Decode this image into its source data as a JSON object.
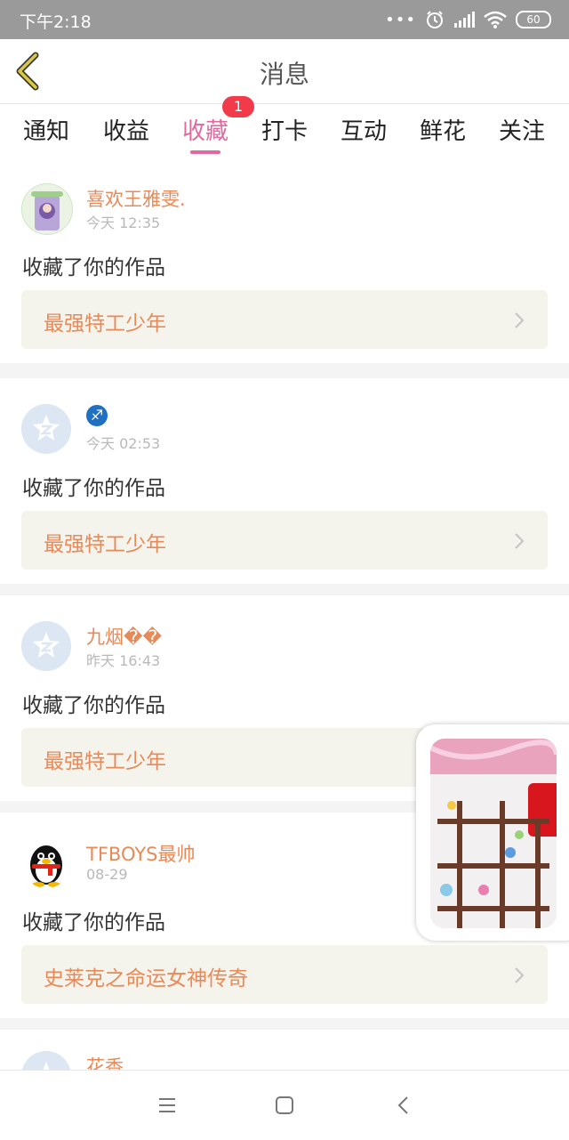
{
  "status_bar": {
    "time": "下午2:18",
    "signal_dots": "•••",
    "battery": "60",
    "icons": [
      "alarm-icon",
      "signal-icon",
      "wifi-icon",
      "battery-icon"
    ]
  },
  "header": {
    "title": "消息",
    "back_icon": "back-chevron-icon",
    "accent_color": "#d9c84a"
  },
  "tabs": {
    "items": [
      "通知",
      "收益",
      "收藏",
      "打卡",
      "互动",
      "鲜花",
      "关注"
    ],
    "active": "收藏",
    "badge": "1",
    "active_color": "#e06aa0"
  },
  "messages": [
    {
      "user": "喜欢王雅雯.",
      "time": "今天 12:35",
      "action": "收藏了你的作品",
      "work": "最强特工少年"
    },
    {
      "user": "♐",
      "time": "今天 02:53",
      "action": "收藏了你的作品",
      "work": "最强特工少年"
    },
    {
      "user": "九烟��",
      "time": "昨天 16:43",
      "action": "收藏了你的作品",
      "work": "最强特工少年"
    },
    {
      "user": "TFBOYS最帅",
      "time": "08-29",
      "action": "收藏了你的作品",
      "work": "史莱克之命运女神传奇"
    },
    {
      "user": "花香"
    }
  ],
  "colors": {
    "username": "#e88a58",
    "work_title": "#e88a58",
    "work_bg": "#f4f3ec",
    "badge": "#f23a4a"
  },
  "bottom_nav": [
    "menu-icon",
    "home-square-icon",
    "back-icon"
  ]
}
